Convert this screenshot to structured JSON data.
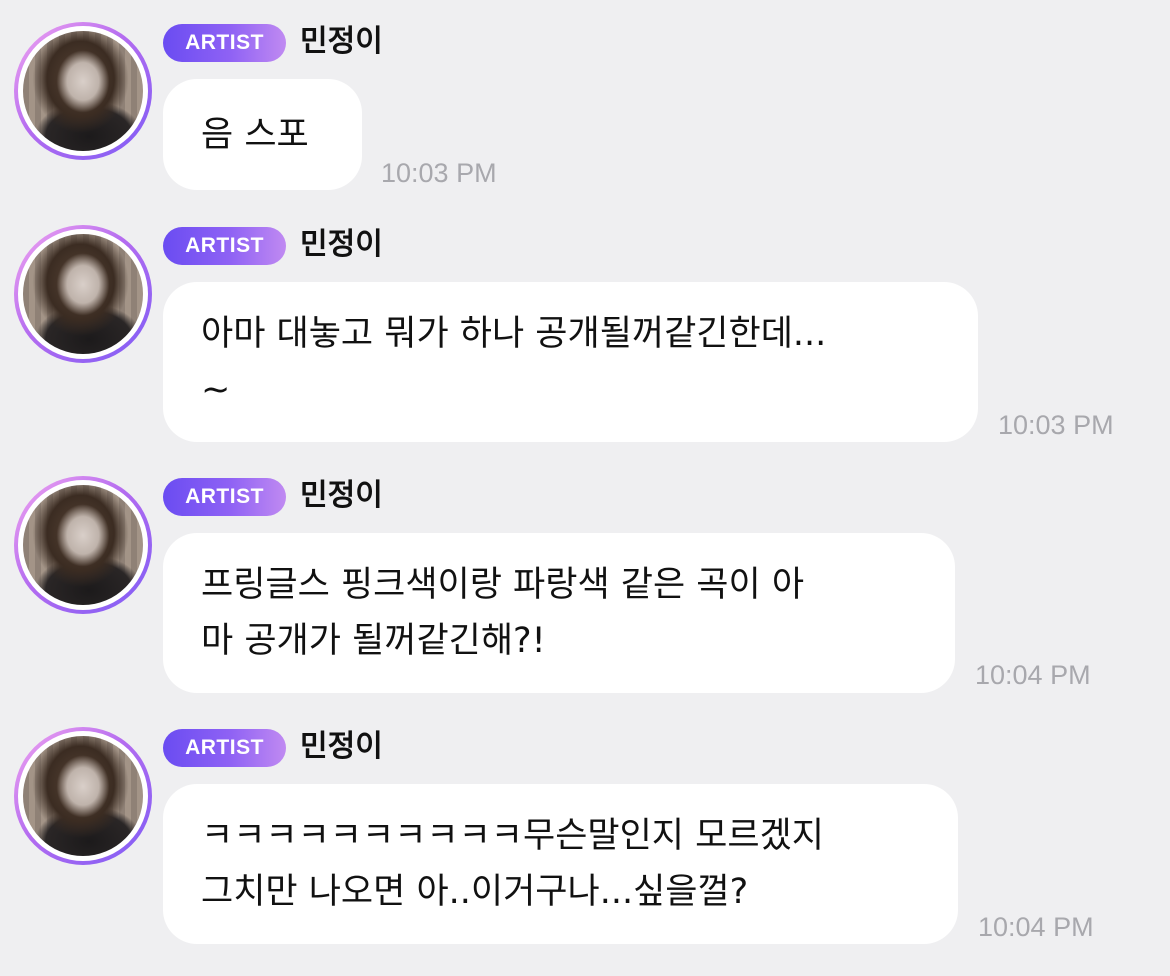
{
  "messages": [
    {
      "badge": "ARTIST",
      "sender": "민정이",
      "lines": [
        "음 스포"
      ],
      "time": "10:03 PM"
    },
    {
      "badge": "ARTIST",
      "sender": "민정이",
      "lines": [
        "아마 대놓고 뭐가 하나 공개될꺼같긴한데...",
        "~"
      ],
      "time": "10:03 PM"
    },
    {
      "badge": "ARTIST",
      "sender": "민정이",
      "lines": [
        "프링글스 핑크색이랑 파랑색 같은 곡이 아",
        "마 공개가 될꺼같긴해?!"
      ],
      "time": "10:04 PM"
    },
    {
      "badge": "ARTIST",
      "sender": "민정이",
      "lines": [
        "ㅋㅋㅋㅋㅋㅋㅋㅋㅋㅋ무슨말인지 모르겠지",
        "그치만 나오면 아..이거구나...싶을껄?"
      ],
      "time": "10:04 PM"
    }
  ]
}
